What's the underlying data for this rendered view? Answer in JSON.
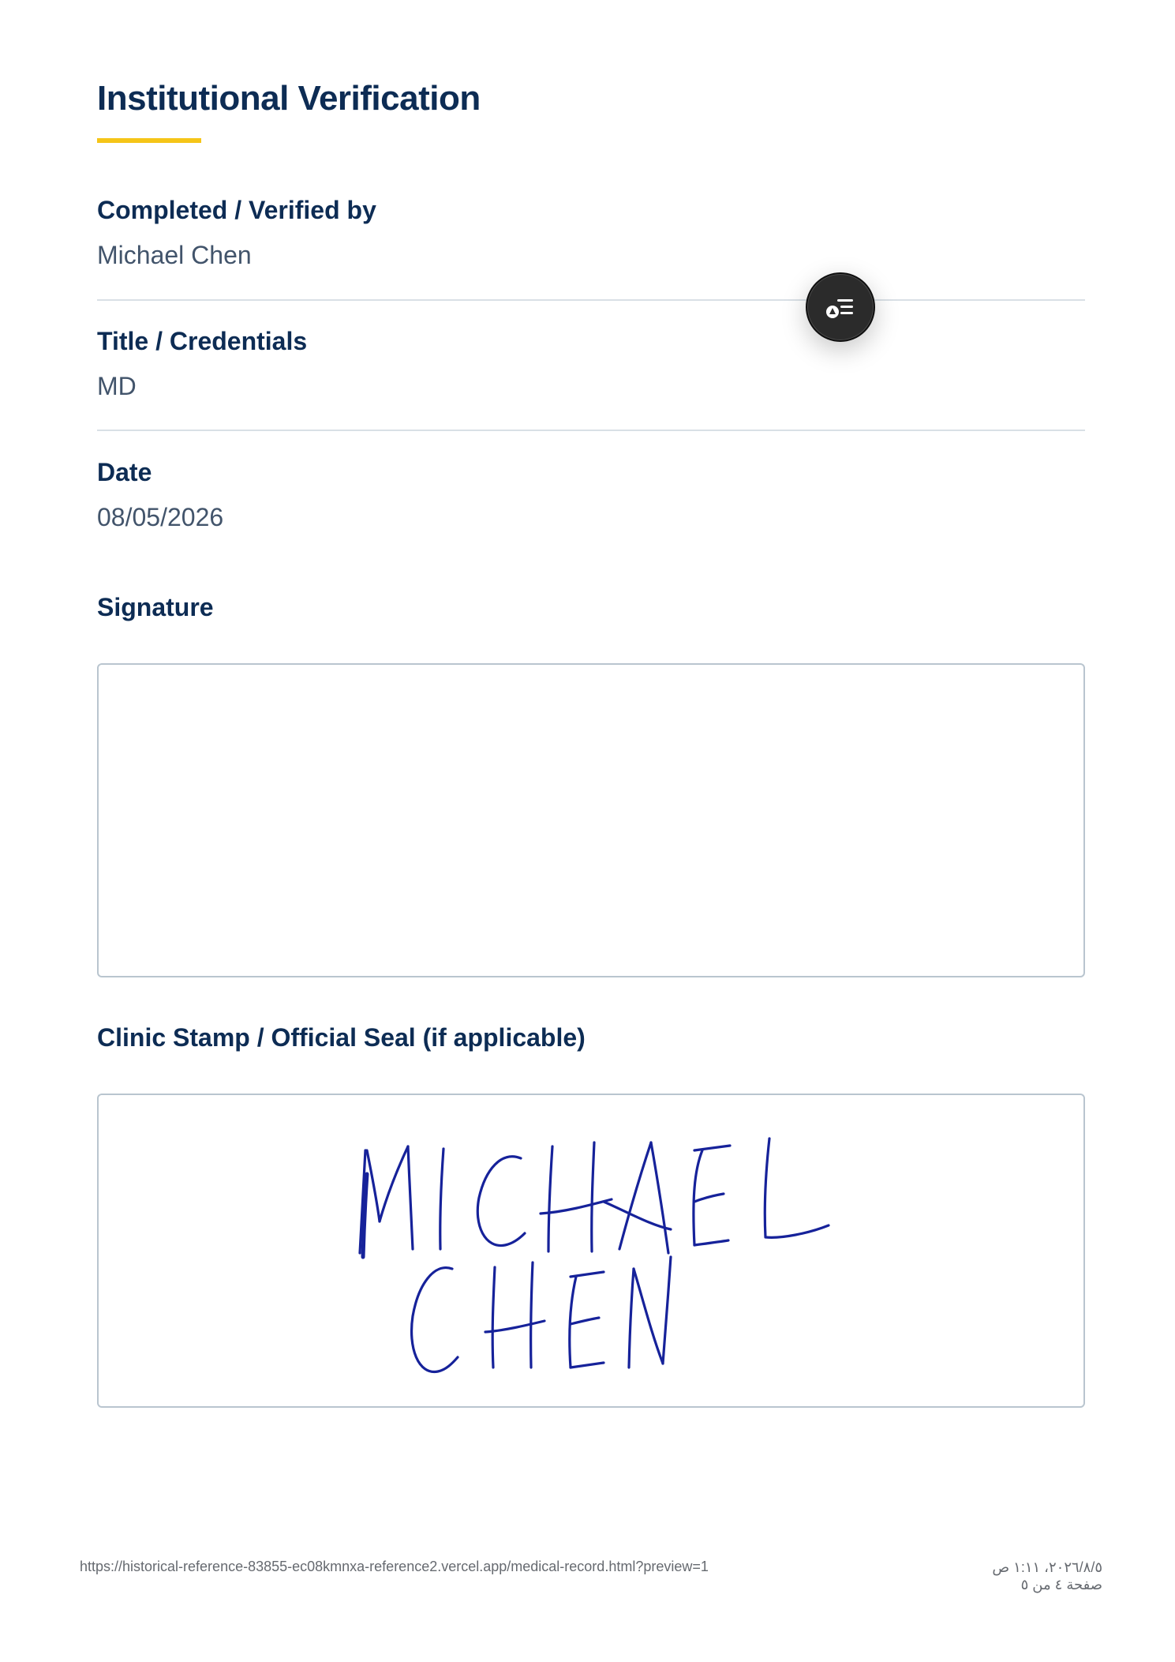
{
  "section": {
    "title": "Institutional Verification"
  },
  "fields": {
    "verified_by_label": "Completed / Verified by",
    "verified_by_value": "Michael Chen",
    "title_label": "Title / Credentials",
    "title_value": "MD",
    "date_label": "Date",
    "date_value": "08/05/2026",
    "signature_label": "Signature",
    "stamp_label": "Clinic Stamp / Official Seal (if applicable)"
  },
  "stamp": {
    "handwritten_line1": "MICHAEL",
    "handwritten_line2": "CHEN",
    "ink_color": "#16229a"
  },
  "fab": {
    "icon": "list-filter-icon"
  },
  "footer": {
    "url": "https://historical-reference-83855-ec08kmnxa-reference2.vercel.app/medical-record.html?preview=1",
    "datetime": "٢٠٢٦/٨/٥، ١:١١ ص",
    "page_info": "صفحة ٤ من ٥"
  },
  "colors": {
    "heading": "#0d2c54",
    "accent": "#f5c518",
    "value_text": "#42546b",
    "divider": "#d9e0e6",
    "box_border": "#b9c5cf"
  }
}
